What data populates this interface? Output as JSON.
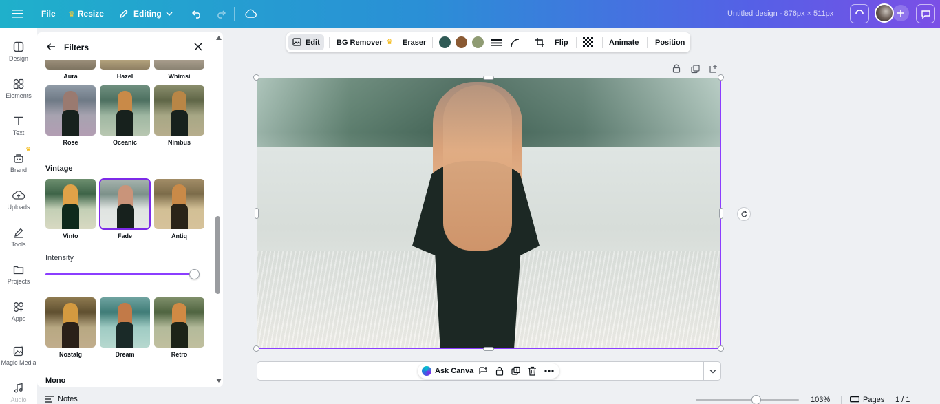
{
  "topbar": {
    "file_label": "File",
    "resize_label": "Resize",
    "editing_label": "Editing",
    "design_title": "Untitled design - 876px × 511px"
  },
  "rail": {
    "items": [
      {
        "label": "Design",
        "icon": "design-icon"
      },
      {
        "label": "Elements",
        "icon": "elements-icon"
      },
      {
        "label": "Text",
        "icon": "text-icon"
      },
      {
        "label": "Brand",
        "icon": "brand-icon"
      },
      {
        "label": "Uploads",
        "icon": "uploads-icon"
      },
      {
        "label": "Tools",
        "icon": "tools-icon"
      },
      {
        "label": "Projects",
        "icon": "projects-icon"
      },
      {
        "label": "Apps",
        "icon": "apps-icon"
      },
      {
        "label": "Magic Media",
        "icon": "magic-media-icon"
      },
      {
        "label": "Audio",
        "icon": "audio-icon"
      }
    ]
  },
  "panel": {
    "title": "Filters",
    "top_row": [
      "Aura",
      "Hazel",
      "Whimsi"
    ],
    "row2": [
      "Rose",
      "Oceanic",
      "Nimbus"
    ],
    "vintage_heading": "Vintage",
    "vintage_row": [
      "Vinto",
      "Fade",
      "Antiq"
    ],
    "selected_filter": "Fade",
    "intensity_label": "Intensity",
    "intensity_value": 1.0,
    "row4": [
      "Nostalg",
      "Dream",
      "Retro"
    ],
    "mono_heading": "Mono"
  },
  "context_bar": {
    "edit_label": "Edit",
    "bg_remover_label": "BG Remover",
    "eraser_label": "Eraser",
    "colors": [
      "#2f5a55",
      "#8a5a33",
      "#8f9b73"
    ],
    "flip_label": "Flip",
    "animate_label": "Animate",
    "position_label": "Position"
  },
  "ask": {
    "label": "Ask Canva"
  },
  "footer": {
    "notes_label": "Notes",
    "zoom_value": "103%",
    "pages_label": "Pages",
    "page_count": "1 / 1"
  },
  "colors": {
    "accent": "#8b3dff",
    "topbar_start": "#1fb0cb",
    "topbar_end": "#7b4fe6"
  }
}
